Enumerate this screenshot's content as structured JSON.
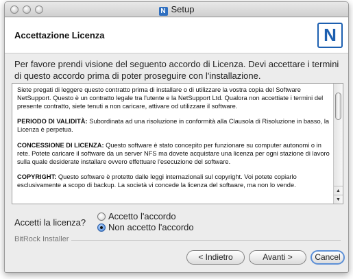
{
  "window": {
    "title": "Setup",
    "title_icon_glyph": "N"
  },
  "header": {
    "title": "Accettazione Licenza",
    "logo_letter": "N",
    "logo_color": "#1c5fb0"
  },
  "intro": "Per favore prendi visione del seguento accordo di Licenza. Devi accettare i termini di questo accordo prima di poter proseguire con l'installazione.",
  "license": {
    "p1": "Siete pregati di leggere questo contratto prima di installare o di utilizzare la vostra copia del Software NetSupport. Questo è un contratto legale tra l'utente e la NetSupport Ltd. Qualora non accettiate i termini del presente contratto, siete tenuti a non caricare, attivare od utilizzare il software.",
    "p2_heading": "PERIODO DI VALIDITÀ:",
    "p2_text": " Subordinata ad una risoluzione in conformità alla Clausola di Risoluzione in basso, la Licenza è perpetua.",
    "p3_heading": "CONCESSIONE DI LICENZA:",
    "p3_text": " Questo software è stato concepito per funzionare su computer autonomi o in rete. Potete caricare il software da un server NFS ma dovete acquistare una licenza per ogni stazione di lavoro sulla quale desiderate installare ovvero effettuare l'esecuzione del software.",
    "p4_heading": "COPYRIGHT:",
    "p4_text": " Questo software è protetto dalle leggi internazionali sul copyright. Voi potete copiarlo esclusivamente a scopo di backup. La società vi concede la licenza del software, ma non lo vende."
  },
  "accept": {
    "label": "Accetti la licenza?",
    "option_accept": "Accetto l'accordo",
    "option_decline": "Non accetto l'accordo",
    "selected": "option_decline"
  },
  "installer_label": "BitRock Installer",
  "buttons": {
    "back": "< Indietro",
    "next": "Avanti >",
    "cancel": "Cancel"
  }
}
